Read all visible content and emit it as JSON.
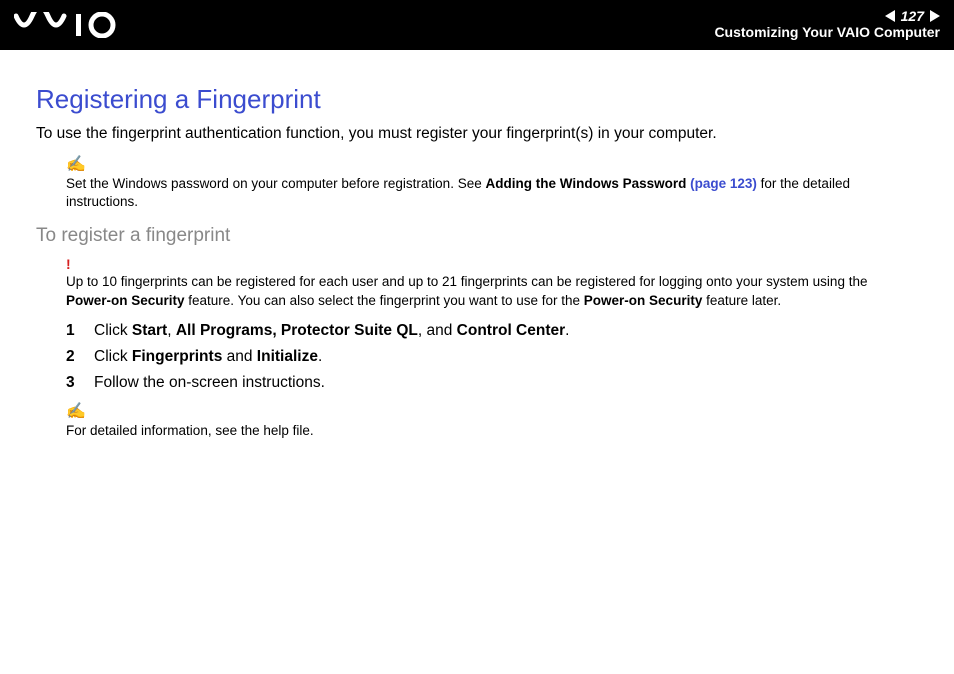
{
  "header": {
    "page_number": "127",
    "section_title": "Customizing Your VAIO Computer"
  },
  "title": "Registering a Fingerprint",
  "intro": "To use the fingerprint authentication function, you must register your fingerprint(s) in your computer.",
  "note1": {
    "pre": "Set the Windows password on your computer before registration. See ",
    "link_bold": "Adding the Windows Password ",
    "link_page": "(page 123)",
    "post": " for the detailed instructions."
  },
  "subhead": "To register a fingerprint",
  "warning": {
    "mark": "!",
    "pre": "Up to 10 fingerprints can be registered for each user and up to 21 fingerprints can be registered for logging onto your system using the ",
    "bold1": "Power-on Security",
    "mid": " feature. You can also select the fingerprint you want to use for the ",
    "bold2": "Power-on Security",
    "post": " feature later."
  },
  "steps": [
    {
      "num": "1",
      "pre": "Click ",
      "b1": "Start",
      "s1": ", ",
      "b2": "All Programs, Protector Suite QL",
      "s2": ", and ",
      "b3": "Control Center",
      "post": "."
    },
    {
      "num": "2",
      "pre": "Click ",
      "b1": "Fingerprints",
      "s1": " and ",
      "b2": "Initialize",
      "post": "."
    },
    {
      "num": "3",
      "pre": "Follow the on-screen instructions."
    }
  ],
  "note2": "For detailed information, see the help file."
}
